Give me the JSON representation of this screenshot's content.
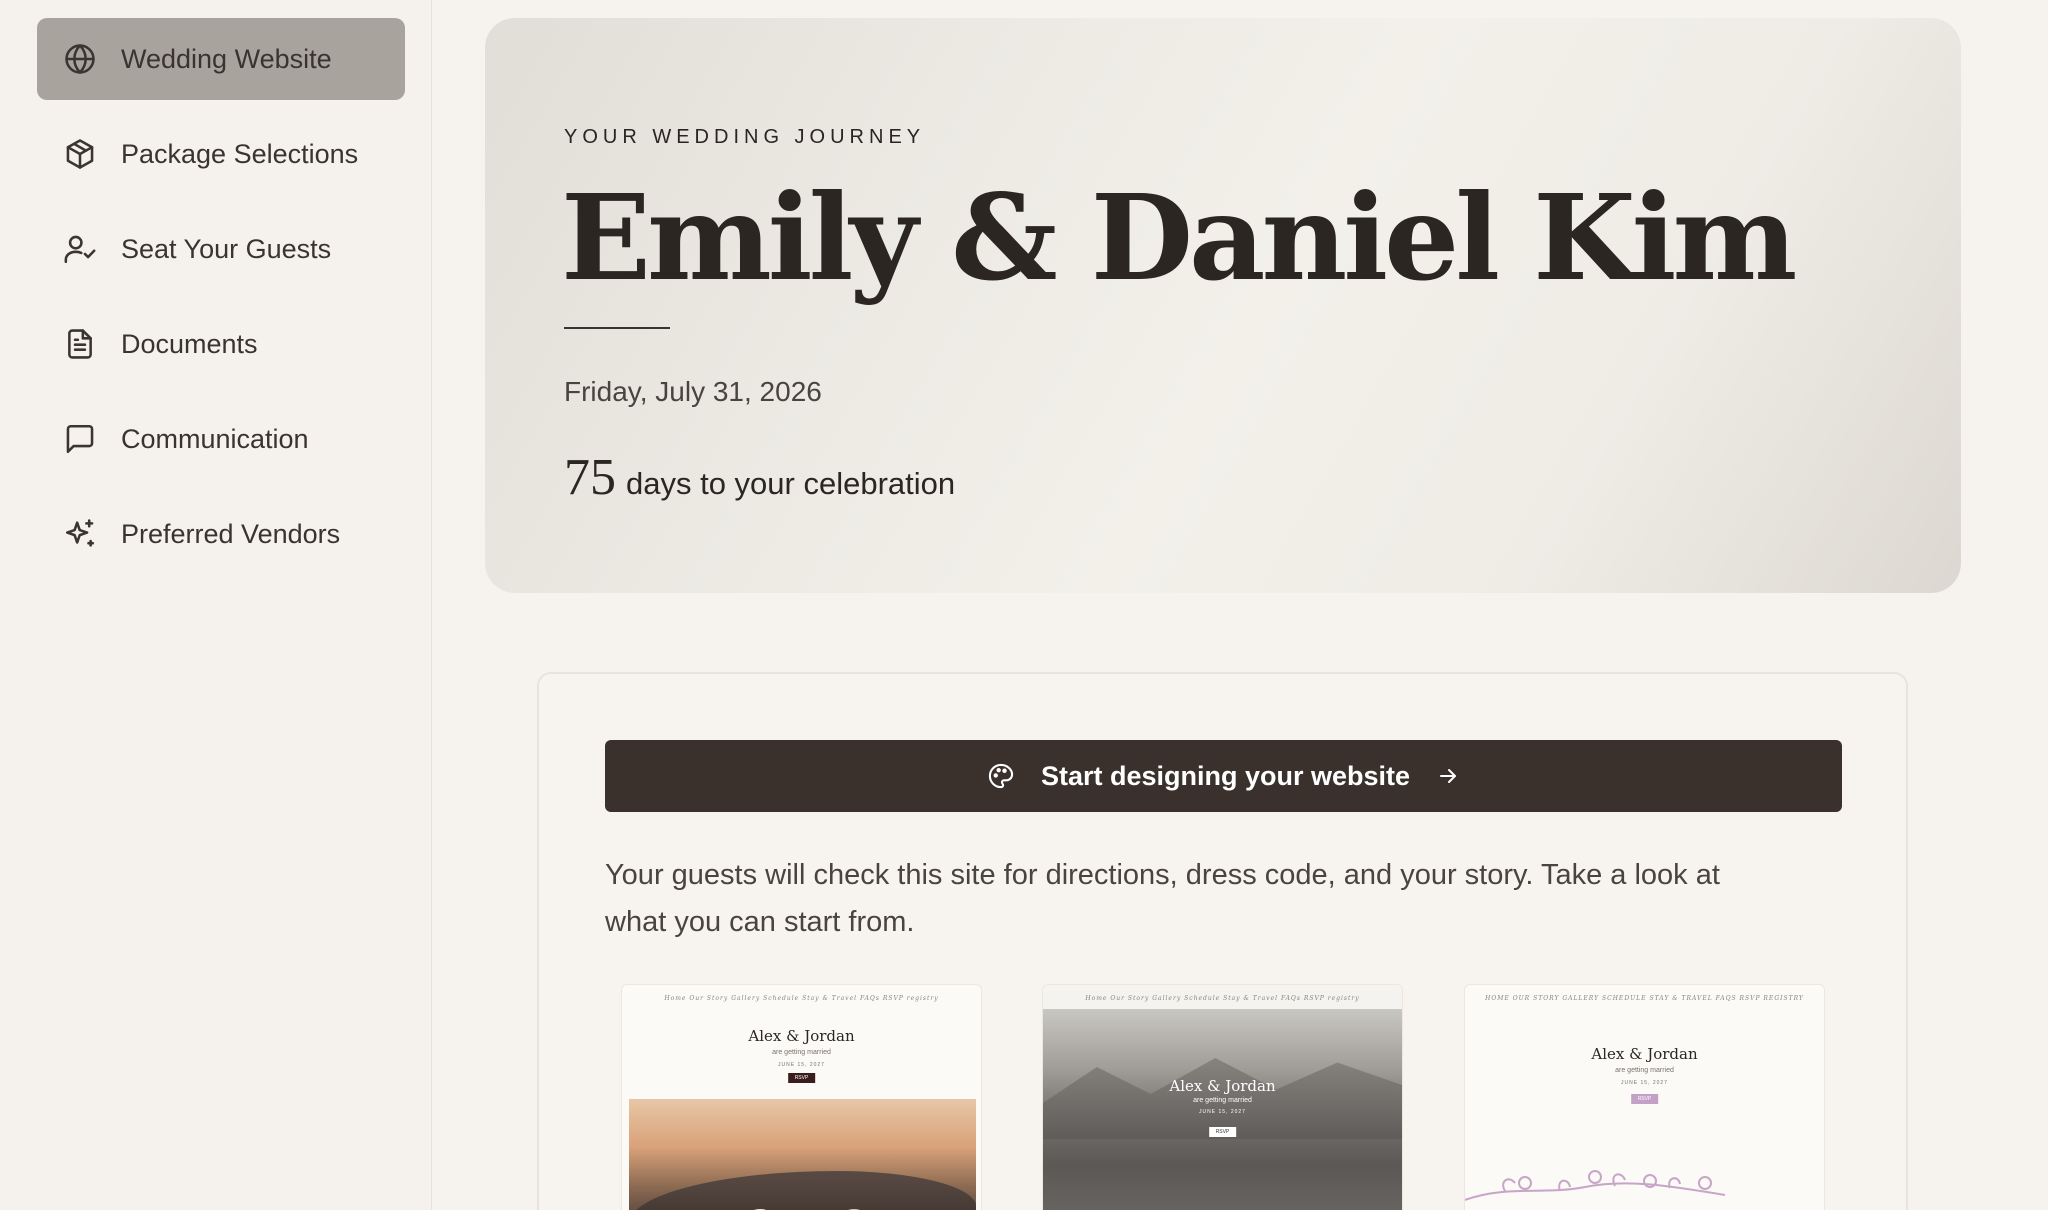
{
  "sidebar": {
    "items": [
      {
        "label": "Wedding Website",
        "icon": "globe-icon",
        "active": true
      },
      {
        "label": "Package Selections",
        "icon": "package-icon",
        "active": false
      },
      {
        "label": "Seat Your Guests",
        "icon": "user-check-icon",
        "active": false
      },
      {
        "label": "Documents",
        "icon": "document-icon",
        "active": false
      },
      {
        "label": "Communication",
        "icon": "message-icon",
        "active": false
      },
      {
        "label": "Preferred Vendors",
        "icon": "sparkles-icon",
        "active": false
      }
    ]
  },
  "hero": {
    "kicker": "YOUR WEDDING JOURNEY",
    "title": "Emily & Daniel Kim",
    "date": "Friday, July 31, 2026",
    "countdown_number": "75",
    "countdown_text": "days to your celebration"
  },
  "website_card": {
    "cta_label": "Start designing your website",
    "description": "Your guests will check this site for directions, dress code, and your story. Take a look at what you can start from.",
    "templates": [
      {
        "nav": "Home   Our Story   Gallery   Schedule   Stay & Travel   FAQs   RSVP   registry",
        "names": "Alex & Jordan",
        "subtitle": "are getting married",
        "date": "JUNE 15, 2027",
        "button": "RSVP"
      },
      {
        "nav": "Home   Our Story   Gallery   Schedule   Stay & Travel   FAQs   RSVP   registry",
        "names": "Alex & Jordan",
        "subtitle": "are getting married",
        "date": "JUNE 15, 2027",
        "button": "RSVP"
      },
      {
        "nav": "HOME   OUR STORY   GALLERY   SCHEDULE   STAY & TRAVEL   FAQS   RSVP   REGISTRY",
        "names": "Alex & Jordan",
        "subtitle": "are getting married",
        "date": "JUNE 15, 2027",
        "button": "RSVP"
      }
    ]
  },
  "colors": {
    "background": "#f6f3ee",
    "active_nav": "#a9a39d",
    "cta": "#3a302c",
    "text": "#2f2a27"
  }
}
